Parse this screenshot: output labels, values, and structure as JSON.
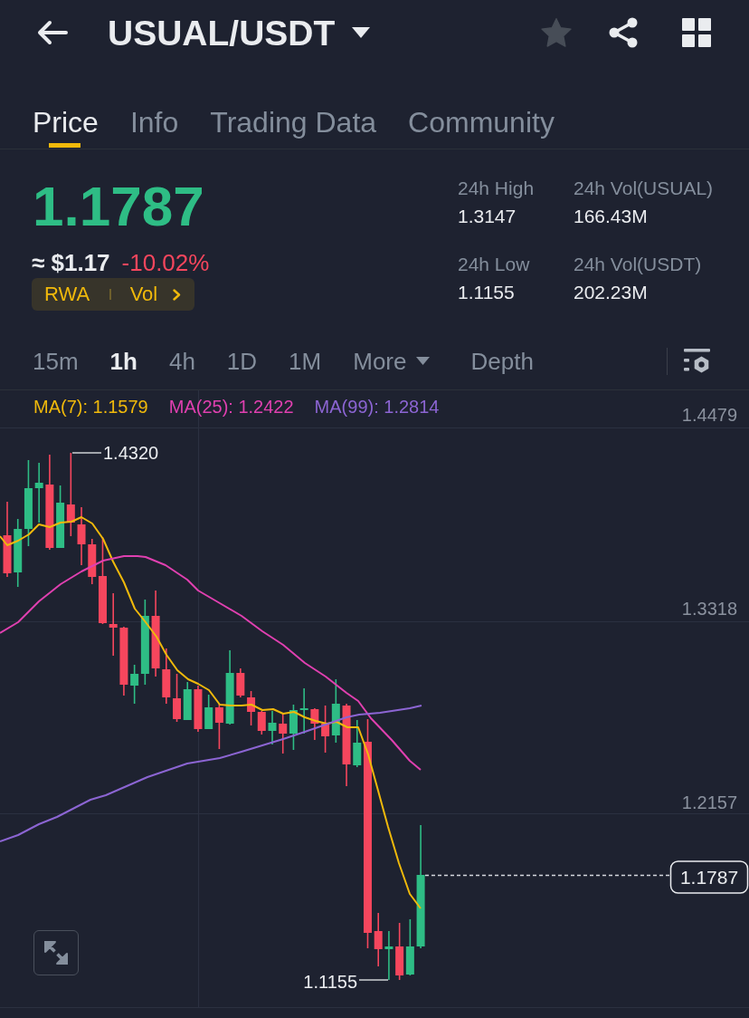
{
  "header": {
    "title": "USUAL/USDT"
  },
  "tabs": [
    {
      "label": "Price",
      "selected": true
    },
    {
      "label": "Info",
      "selected": false
    },
    {
      "label": "Trading Data",
      "selected": false
    },
    {
      "label": "Community",
      "selected": false
    }
  ],
  "ticker": {
    "price": "1.1787",
    "approx": "≈ $1.17",
    "change": "-10.02%",
    "tags": [
      "RWA",
      "Vol"
    ]
  },
  "stats": [
    {
      "label": "24h High",
      "value": "1.3147"
    },
    {
      "label": "24h Vol(USUAL)",
      "value": "166.43M"
    },
    {
      "label": "24h Low",
      "value": "1.1155"
    },
    {
      "label": "24h Vol(USDT)",
      "value": "202.23M"
    }
  ],
  "intervals": [
    {
      "label": "15m",
      "kind": "interval",
      "selected": false
    },
    {
      "label": "1h",
      "kind": "interval",
      "selected": true
    },
    {
      "label": "4h",
      "kind": "interval",
      "selected": false
    },
    {
      "label": "1D",
      "kind": "interval",
      "selected": false
    },
    {
      "label": "1M",
      "kind": "interval",
      "selected": false
    },
    {
      "label": "More",
      "kind": "menu",
      "selected": false
    },
    {
      "label": "Depth",
      "kind": "view",
      "selected": false
    }
  ],
  "chart": {
    "indicators": [
      {
        "label": "MA(7): 1.1579",
        "color": "#f0b90b"
      },
      {
        "label": "MA(25): 1.2422",
        "color": "#e040b0"
      },
      {
        "label": "MA(99): 1.2814",
        "color": "#8c65d3"
      }
    ],
    "axis_labels": [
      "1.4479",
      "1.3318",
      "1.2157"
    ],
    "high_label": "1.4320",
    "low_label": "1.1155",
    "last_price": "1.1787"
  }
}
